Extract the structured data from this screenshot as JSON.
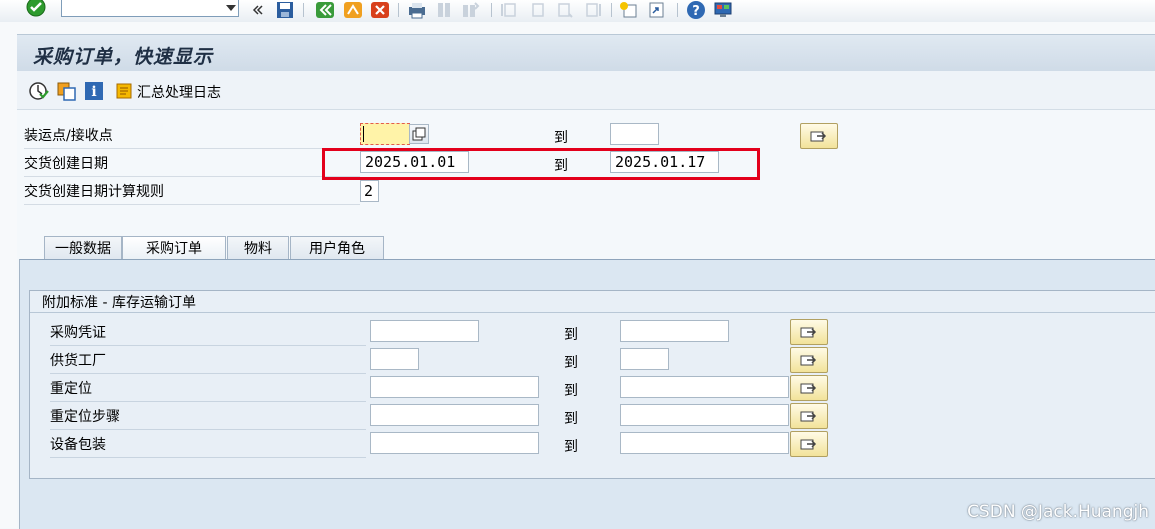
{
  "window": {
    "title": "采购订单，快速显示"
  },
  "toolbar": {
    "command_field_value": "",
    "icons": [
      "enter-check-icon",
      "command-dropdown-icon",
      "collapse-icon",
      "save-icon",
      "back-icon",
      "exit-icon",
      "cancel-icon",
      "print-icon",
      "find-icon",
      "find-next-icon",
      "first-page-icon",
      "prev-page-icon",
      "next-page-icon",
      "last-page-icon",
      "new-session-icon",
      "shortcut-icon",
      "help-icon",
      "layout-icon"
    ]
  },
  "app_toolbar": {
    "log_label": "汇总处理日志"
  },
  "selection": {
    "rows": [
      {
        "label": "装运点/接收点",
        "from": "",
        "to_label": "到",
        "to": ""
      },
      {
        "label": "交货创建日期",
        "from": "2025.01.01",
        "to_label": "到",
        "to": "2025.01.17"
      },
      {
        "label": "交货创建日期计算规则",
        "value": "2"
      }
    ]
  },
  "tabs": [
    {
      "label": "一般数据"
    },
    {
      "label": "采购订单",
      "active": true
    },
    {
      "label": "物料"
    },
    {
      "label": "用户角色"
    }
  ],
  "group": {
    "title": "附加标准 - 库存运输订单",
    "rows": [
      {
        "label": "采购凭证",
        "from": "",
        "to_label": "到",
        "to": ""
      },
      {
        "label": "供货工厂",
        "from": "",
        "to_label": "到",
        "to": ""
      },
      {
        "label": "重定位",
        "from": "",
        "to_label": "到",
        "to": ""
      },
      {
        "label": "重定位步骤",
        "from": "",
        "to_label": "到",
        "to": ""
      },
      {
        "label": "设备包装",
        "from": "",
        "to_label": "到",
        "to": ""
      }
    ]
  },
  "watermark": "CSDN @Jack.Huangjh",
  "colors": {
    "highlight_box": "#e3001b",
    "input_focus": "#fff3a8",
    "title_bg": "#d6e1ec"
  }
}
